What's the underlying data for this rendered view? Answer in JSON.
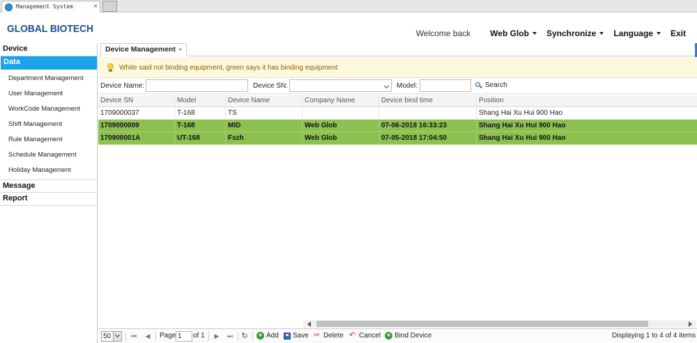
{
  "browser": {
    "tab_title": "Management System",
    "tab_close": "×"
  },
  "header": {
    "logo": "GLOBAL BIOTECH",
    "welcome": "Welcome back",
    "user": "Web Glob",
    "synchronize": "Synchronize",
    "language": "Language",
    "exit": "Exit"
  },
  "sidebar": {
    "sections": {
      "device": "Device",
      "data": "Data",
      "message": "Message",
      "report": "Report"
    },
    "items": [
      {
        "label": "Department Management"
      },
      {
        "label": "User Management"
      },
      {
        "label": "WorkCode Management"
      },
      {
        "label": "Shift Management"
      },
      {
        "label": "Rule Management"
      },
      {
        "label": "Schedule Management"
      },
      {
        "label": "Holiday Management"
      }
    ]
  },
  "main": {
    "tab": {
      "label": "Device Management",
      "close": "×"
    },
    "notice": "White said not binding equipment, green says it has binding equipment",
    "filters": {
      "device_name_label": "Device Name:",
      "device_name_value": "",
      "device_sn_label": "Device SN:",
      "device_sn_value": "",
      "model_label": "Model:",
      "model_value": "",
      "search_label": "Search"
    },
    "grid": {
      "columns": [
        "Device SN",
        "Model",
        "Device Name",
        "Company Name",
        "Device bind time",
        "Position"
      ],
      "rows": [
        {
          "sn": "1709000037",
          "model": "T-168",
          "name": "TS",
          "company": "",
          "bind_time": "",
          "position": "Shang Hai Xu Hui 900 Hao",
          "bound": false
        },
        {
          "sn": "1709000009",
          "model": "T-168",
          "name": "MID",
          "company": "Web Glob",
          "bind_time": "07-06-2018 16:33:23",
          "position": "Shang Hai Xu Hui 900 Hao",
          "bound": true
        },
        {
          "sn": "170900001A",
          "model": "UT-168",
          "name": "Fszh",
          "company": "Web Glob",
          "bind_time": "07-05-2018 17:04:50",
          "position": "Shang Hai Xu Hui 900 Hao",
          "bound": true
        }
      ]
    },
    "pager": {
      "page_size": "50",
      "page_label": "Page",
      "page_value": "1",
      "of_label": "of 1",
      "add": "Add",
      "save": "Save",
      "delete": "Delete",
      "cancel": "Cancel",
      "bind_device": "Bind Device",
      "display": "Displaying 1 to 4 of 4 items"
    }
  },
  "colors": {
    "accent": "#1aa3e8",
    "bound_row": "#8cc152",
    "logo": "#1d4f95"
  }
}
